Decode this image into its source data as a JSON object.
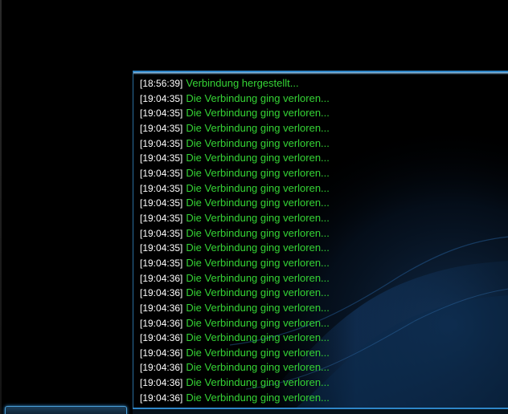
{
  "log": {
    "time_color": "#ffffff",
    "message_color": "#35d435",
    "entries": [
      {
        "time": "[18:56:39]",
        "message": "Verbindung hergestellt..."
      },
      {
        "time": "[19:04:35]",
        "message": "Die Verbindung ging verloren..."
      },
      {
        "time": "[19:04:35]",
        "message": "Die Verbindung ging verloren..."
      },
      {
        "time": "[19:04:35]",
        "message": "Die Verbindung ging verloren..."
      },
      {
        "time": "[19:04:35]",
        "message": "Die Verbindung ging verloren..."
      },
      {
        "time": "[19:04:35]",
        "message": "Die Verbindung ging verloren..."
      },
      {
        "time": "[19:04:35]",
        "message": "Die Verbindung ging verloren..."
      },
      {
        "time": "[19:04:35]",
        "message": "Die Verbindung ging verloren..."
      },
      {
        "time": "[19:04:35]",
        "message": "Die Verbindung ging verloren..."
      },
      {
        "time": "[19:04:35]",
        "message": "Die Verbindung ging verloren..."
      },
      {
        "time": "[19:04:35]",
        "message": "Die Verbindung ging verloren..."
      },
      {
        "time": "[19:04:35]",
        "message": "Die Verbindung ging verloren..."
      },
      {
        "time": "[19:04:35]",
        "message": "Die Verbindung ging verloren..."
      },
      {
        "time": "[19:04:36]",
        "message": "Die Verbindung ging verloren..."
      },
      {
        "time": "[19:04:36]",
        "message": "Die Verbindung ging verloren..."
      },
      {
        "time": "[19:04:36]",
        "message": "Die Verbindung ging verloren..."
      },
      {
        "time": "[19:04:36]",
        "message": "Die Verbindung ging verloren..."
      },
      {
        "time": "[19:04:36]",
        "message": "Die Verbindung ging verloren..."
      },
      {
        "time": "[19:04:36]",
        "message": "Die Verbindung ging verloren..."
      },
      {
        "time": "[19:04:36]",
        "message": "Die Verbindung ging verloren..."
      },
      {
        "time": "[19:04:36]",
        "message": "Die Verbindung ging verloren..."
      },
      {
        "time": "[19:04:36]",
        "message": "Die Verbindung ging verloren..."
      }
    ]
  },
  "theme": {
    "background": "#000000",
    "accent": "#2e86c8"
  }
}
